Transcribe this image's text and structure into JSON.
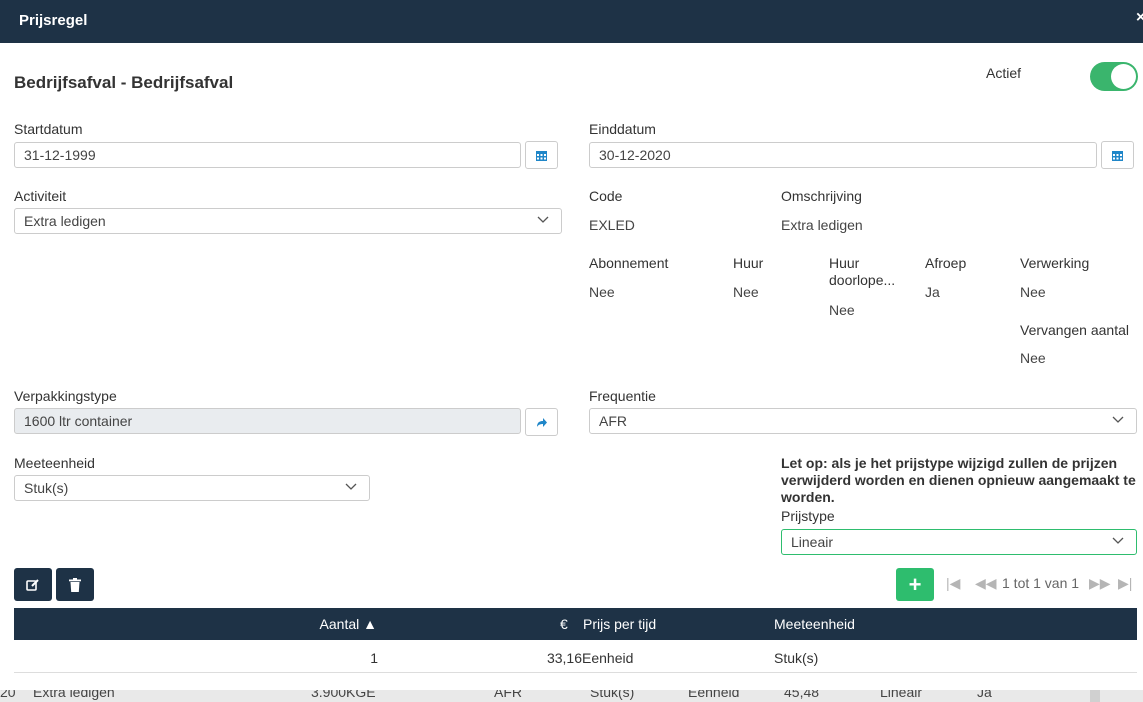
{
  "header": {
    "title": "Prijsregel",
    "close": "×"
  },
  "page_title": "Bedrijfsafval - Bedrijfsafval",
  "actief": {
    "label": "Actief",
    "on": true,
    "color": "#3ab56d"
  },
  "startdatum": {
    "label": "Startdatum",
    "value": "31-12-1999"
  },
  "einddatum": {
    "label": "Einddatum",
    "value": "30-12-2020"
  },
  "activiteit": {
    "label": "Activiteit",
    "value": "Extra ledigen"
  },
  "code": {
    "label": "Code",
    "value": "EXLED"
  },
  "omschrijving": {
    "label": "Omschrijving",
    "value": "Extra ledigen"
  },
  "abonnement": {
    "label": "Abonnement",
    "value": "Nee"
  },
  "huur": {
    "label": "Huur",
    "value": "Nee"
  },
  "huur_doorlopend": {
    "label_line1": "Huur",
    "label_line2": "doorlope...",
    "value": "Nee"
  },
  "afroep": {
    "label": "Afroep",
    "value": "Ja"
  },
  "verwerking": {
    "label": "Verwerking",
    "value": "Nee"
  },
  "vervangen_aantal": {
    "label": "Vervangen aantal",
    "value": "Nee"
  },
  "verpakkingstype": {
    "label": "Verpakkingstype",
    "value": "1600 ltr container"
  },
  "frequentie": {
    "label": "Frequentie",
    "value": "AFR"
  },
  "meeteenheid": {
    "label": "Meeteenheid",
    "value": "Stuk(s)"
  },
  "warning": "Let op: als je het prijstype wijzigd zullen de prijzen verwijderd worden en dienen opnieuw aangemaakt te worden.",
  "prijstype": {
    "label": "Prijstype",
    "value": "Lineair"
  },
  "pager": {
    "text": "1 tot 1 van 1"
  },
  "table": {
    "headers": {
      "aantal": "Aantal ▲",
      "euro": "€",
      "prijs_per_tijd": "Prijs per tijd",
      "meeteenheid": "Meeteenheid"
    },
    "rows": [
      {
        "aantal": "1",
        "euro": "33,16",
        "prijs_per_tijd": "Eenheid",
        "meeteenheid": "Stuk(s)"
      }
    ]
  },
  "background_row": {
    "c0": "20",
    "c1": "Extra ledigen",
    "c2": "3.900KGE",
    "c3": "AFR",
    "c4": "Stuk(s)",
    "c5": "Eenheid",
    "c6": "45,48",
    "c7": "Lineair",
    "c8": "Ja"
  },
  "colors": {
    "header": "#1e3246",
    "accent": "#2ebd6e",
    "icon_blue": "#1f86c8"
  }
}
